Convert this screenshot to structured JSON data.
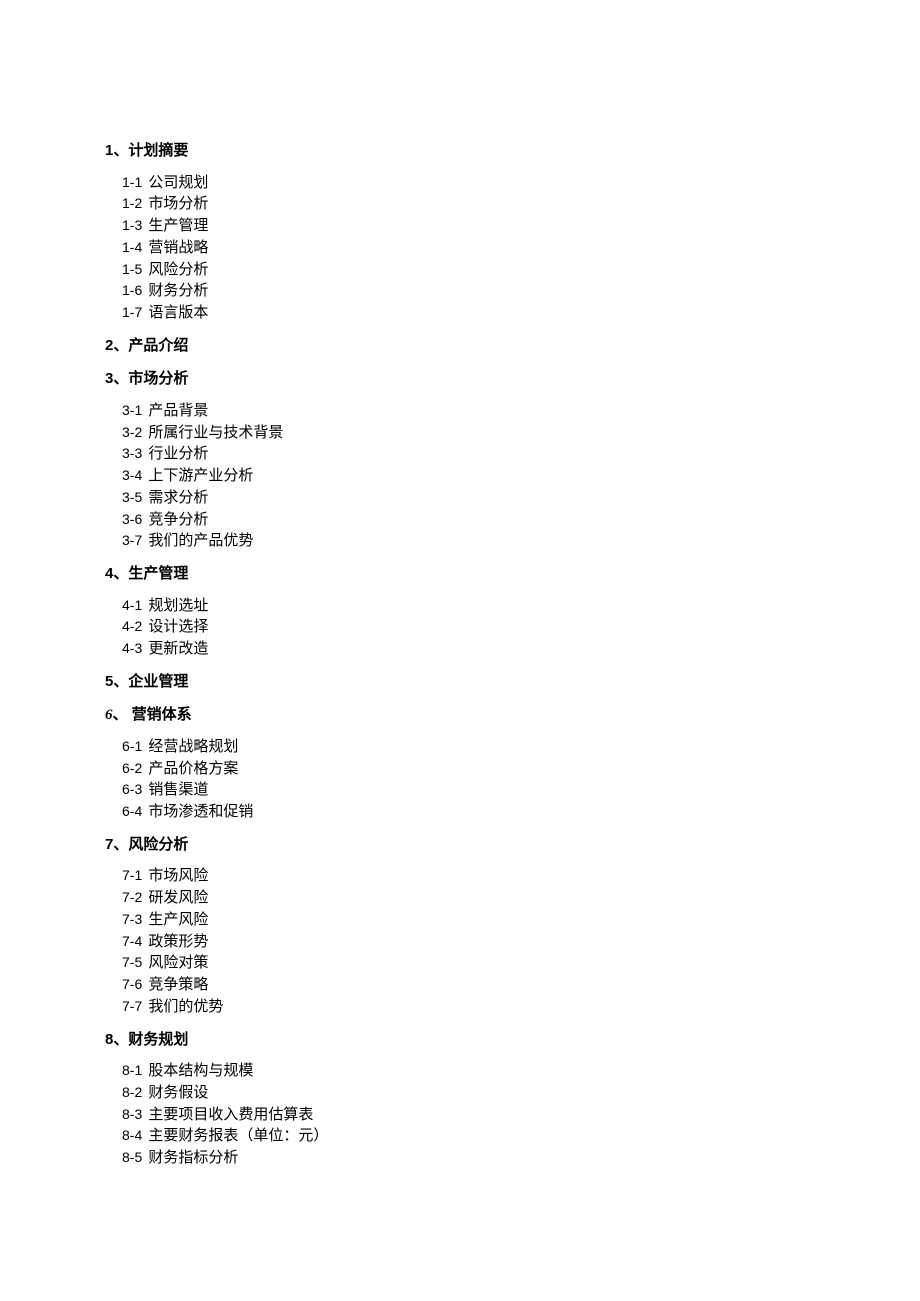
{
  "sections": [
    {
      "num": "1",
      "sep": "、",
      "title": "计划摘要",
      "italic": false,
      "items": [
        {
          "num": "1-1",
          "text": "公司规划"
        },
        {
          "num": "1-2",
          "text": "市场分析"
        },
        {
          "num": "1-3",
          "text": "生产管理"
        },
        {
          "num": "1-4",
          "text": "营销战略"
        },
        {
          "num": "1-5",
          "text": "风险分析"
        },
        {
          "num": "1-6",
          "text": "财务分析"
        },
        {
          "num": "1-7",
          "text": "语言版本"
        }
      ]
    },
    {
      "num": "2",
      "sep": "、",
      "title": "产品介绍",
      "italic": false,
      "items": []
    },
    {
      "num": "3",
      "sep": "、",
      "title": "市场分析",
      "italic": false,
      "items": [
        {
          "num": "3-1",
          "text": "产品背景"
        },
        {
          "num": "3-2",
          "text": "所属行业与技术背景"
        },
        {
          "num": "3-3",
          "text": "行业分析"
        },
        {
          "num": "3-4",
          "text": "上下游产业分析"
        },
        {
          "num": "3-5",
          "text": "需求分析"
        },
        {
          "num": "3-6",
          "text": "竞争分析"
        },
        {
          "num": "3-7",
          "text": "我们的产品优势"
        }
      ]
    },
    {
      "num": "4",
      "sep": "、",
      "title": "生产管理",
      "italic": false,
      "items": [
        {
          "num": "4-1",
          "text": "规划选址"
        },
        {
          "num": "4-2",
          "text": "设计选择"
        },
        {
          "num": "4-3",
          "text": "更新改造"
        }
      ]
    },
    {
      "num": "5",
      "sep": "、",
      "title": "企业管理",
      "italic": false,
      "items": []
    },
    {
      "num": "6",
      "sep": "、 ",
      "title": "营销体系",
      "italic": true,
      "items": [
        {
          "num": "6-1",
          "text": "经营战略规划"
        },
        {
          "num": "6-2",
          "text": "产品价格方案"
        },
        {
          "num": "6-3",
          "text": "销售渠道"
        },
        {
          "num": "6-4",
          "text": "市场渗透和促销"
        }
      ]
    },
    {
      "num": "7",
      "sep": "、",
      "title": "风险分析",
      "italic": false,
      "items": [
        {
          "num": "7-1",
          "text": "市场风险"
        },
        {
          "num": "7-2",
          "text": "研发风险"
        },
        {
          "num": "7-3",
          "text": "生产风险"
        },
        {
          "num": "7-4",
          "text": "政策形势"
        },
        {
          "num": "7-5",
          "text": "风险对策"
        },
        {
          "num": "7-6",
          "text": "竞争策略"
        },
        {
          "num": "7-7",
          "text": "我们的优势"
        }
      ]
    },
    {
      "num": "8",
      "sep": "、",
      "title": "财务规划",
      "italic": false,
      "items": [
        {
          "num": "8-1",
          "text": "股本结构与规模"
        },
        {
          "num": "8-2",
          "text": "财务假设"
        },
        {
          "num": "8-3",
          "text": "主要项目收入费用估算表"
        },
        {
          "num": "8-4",
          "text": "主要财务报表（单位：元）"
        },
        {
          "num": "8-5",
          "text": "财务指标分析"
        }
      ]
    }
  ]
}
